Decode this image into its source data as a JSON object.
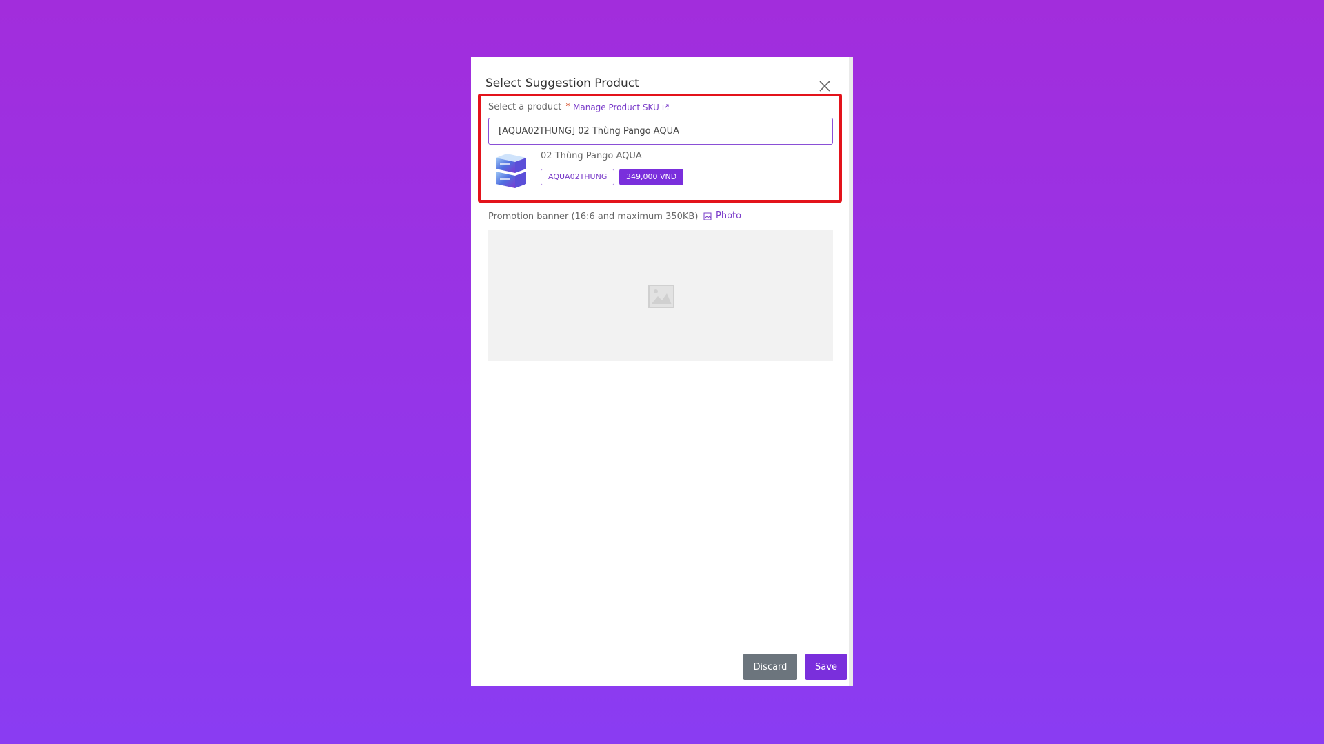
{
  "modal": {
    "title": "Select Suggestion Product"
  },
  "product_field": {
    "label": "Select a product",
    "required_mark": "*",
    "manage_link": "Manage Product SKU",
    "selected_value": "[AQUA02THUNG] 02 Thùng Pango AQUA"
  },
  "selected_product": {
    "name": "02 Thùng Pango AQUA",
    "sku": "AQUA02THUNG",
    "price": "349,000 VND"
  },
  "banner": {
    "label": "Promotion banner (16:6 and maximum 350KB)",
    "photo_button": "Photo"
  },
  "footer": {
    "discard_label": "Discard",
    "save_label": "Save"
  },
  "colors": {
    "accent": "#7a2fdc",
    "highlight_border": "#e3131b",
    "discard_bg": "#6c757d"
  }
}
